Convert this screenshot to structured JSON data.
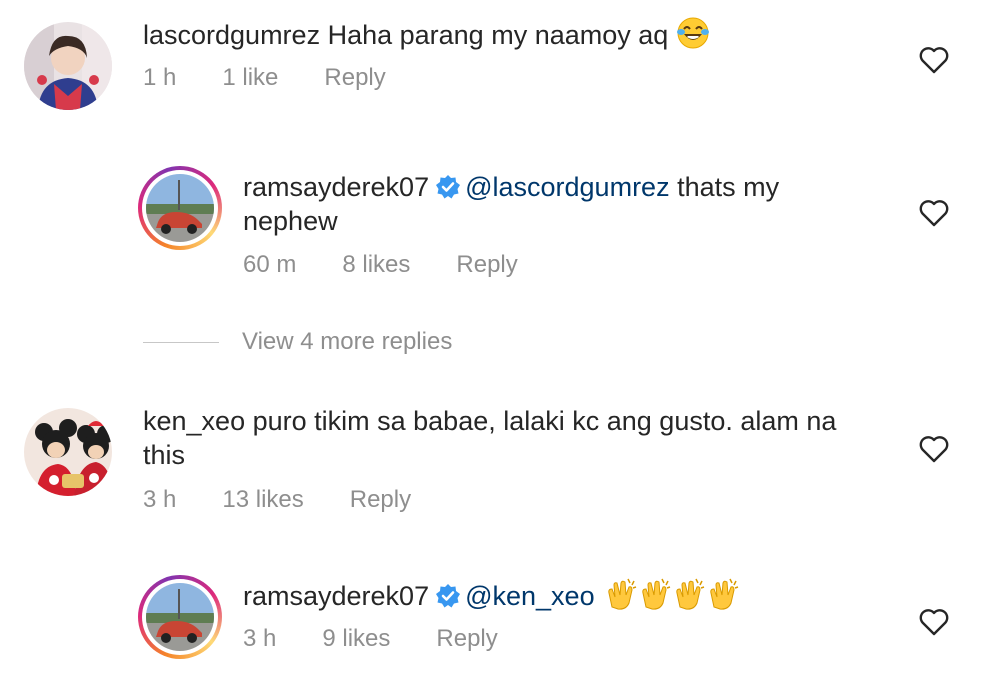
{
  "comments": [
    {
      "username": "lascordgumrez",
      "text": " Haha parang my naamoy aq",
      "emoji": "face-with-tears-of-joy",
      "time": "1 h",
      "likes": "1 like",
      "reply_label": "Reply"
    },
    {
      "username": "ramsayderek07",
      "mention": "@lascordgumrez",
      "text_line1": " thats my",
      "text_line2": "nephew",
      "time": "60 m",
      "likes": "8 likes",
      "reply_label": "Reply"
    },
    {
      "username": "ken_xeo",
      "text_line1": " puro tikim sa babae, lalaki kc ang gusto. alam na",
      "text_line2": "this",
      "time": "3 h",
      "likes": "13 likes",
      "reply_label": "Reply"
    },
    {
      "username": "ramsayderek07",
      "mention": "@ken_xeo",
      "emoji": "clapping-hands x4",
      "time": "3 h",
      "likes": "9 likes",
      "reply_label": "Reply"
    }
  ],
  "view_more_label": "View 4 more replies",
  "icons": {
    "like": "heart-outline-icon",
    "verified": "verified-badge-icon"
  },
  "colors": {
    "text": "#262626",
    "muted": "#8e8e8e",
    "mention": "#00376b",
    "verified": "#3897f0"
  }
}
